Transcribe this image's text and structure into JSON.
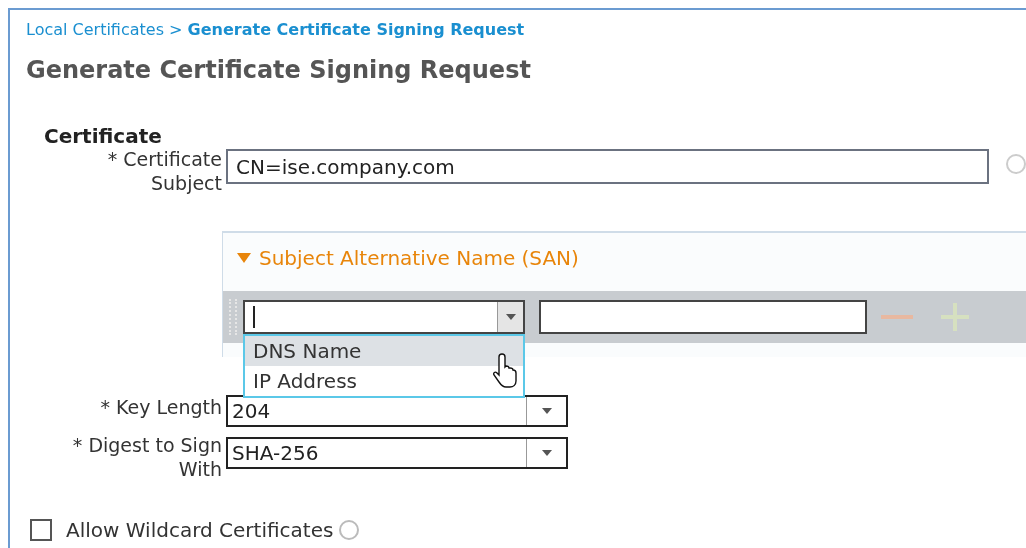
{
  "breadcrumb": {
    "parent": "Local Certificates",
    "separator": ">",
    "current": "Generate Certificate Signing Request"
  },
  "title": "Generate Certificate Signing Request",
  "section": "Certificate",
  "subject": {
    "label_lines": [
      "* Certificate",
      "Subject"
    ],
    "value": "CN=ise.company.com"
  },
  "san": {
    "title": "Subject Alternative Name (SAN)",
    "expanded": true,
    "options": [
      {
        "label": "DNS Name",
        "selected": true
      },
      {
        "label": "IP Address",
        "selected": false
      }
    ]
  },
  "key_length": {
    "label_lines": [
      "* Key Length"
    ],
    "value": "204"
  },
  "digest": {
    "label_lines": [
      "* Digest to Sign",
      "With"
    ],
    "value": "SHA-256"
  },
  "wildcard": {
    "label": "Allow Wildcard Certificates",
    "checked": false
  }
}
